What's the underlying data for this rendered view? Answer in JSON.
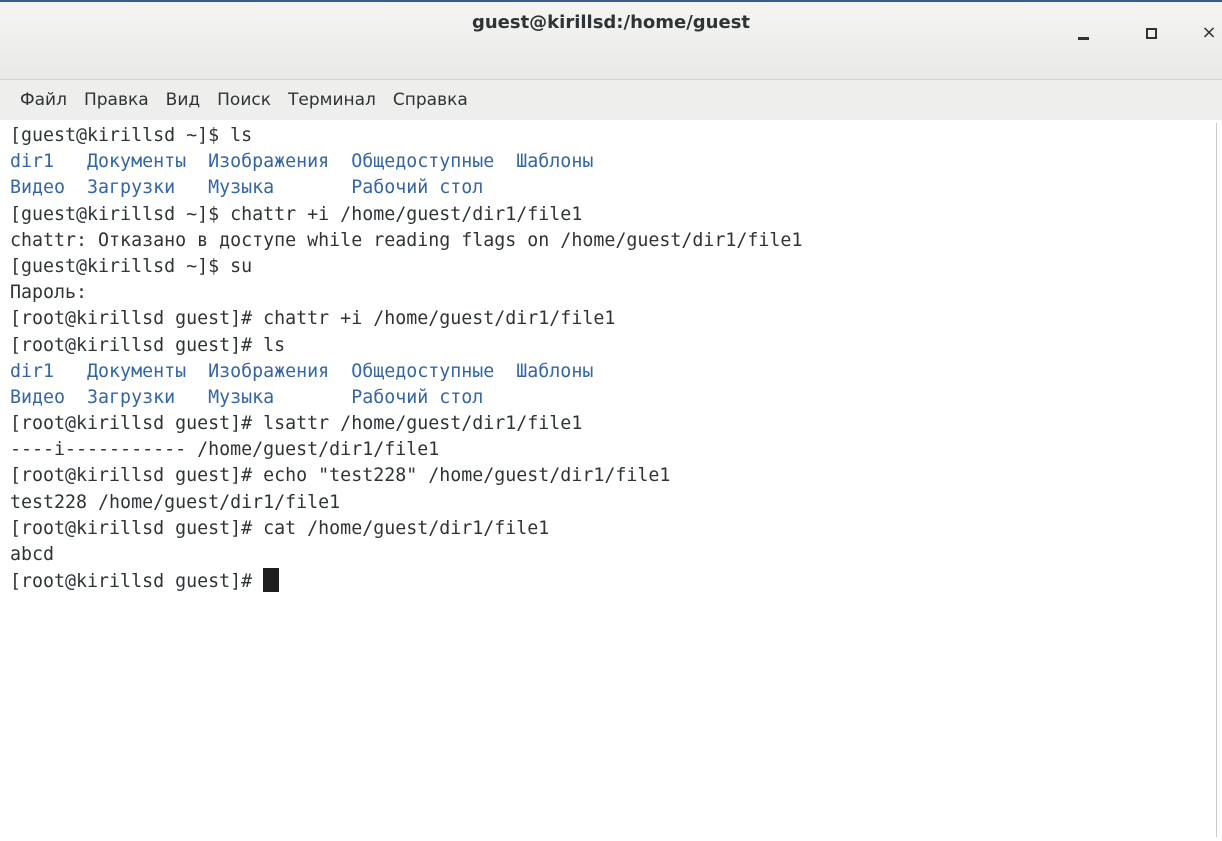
{
  "window": {
    "title": "guest@kirillsd:/home/guest",
    "close_glyph": "×"
  },
  "menu": [
    "Файл",
    "Правка",
    "Вид",
    "Поиск",
    "Терминал",
    "Справка"
  ],
  "colors": {
    "directory": "#3465a4",
    "text": "#2e3436"
  },
  "terminal": {
    "lines": [
      {
        "type": "text",
        "text": "[guest@kirillsd ~]$ ls"
      },
      {
        "type": "dirs",
        "text": "dir1   Документы  Изображения  Общедоступные  Шаблоны"
      },
      {
        "type": "dirs",
        "text": "Видео  Загрузки   Музыка       Рабочий стол"
      },
      {
        "type": "text",
        "text": "[guest@kirillsd ~]$ chattr +i /home/guest/dir1/file1"
      },
      {
        "type": "text",
        "text": "chattr: Отказано в доступе while reading flags on /home/guest/dir1/file1"
      },
      {
        "type": "text",
        "text": "[guest@kirillsd ~]$ su"
      },
      {
        "type": "text",
        "text": "Пароль:"
      },
      {
        "type": "text",
        "text": "[root@kirillsd guest]# chattr +i /home/guest/dir1/file1"
      },
      {
        "type": "text",
        "text": "[root@kirillsd guest]# ls"
      },
      {
        "type": "dirs",
        "text": "dir1   Документы  Изображения  Общедоступные  Шаблоны"
      },
      {
        "type": "dirs",
        "text": "Видео  Загрузки   Музыка       Рабочий стол"
      },
      {
        "type": "text",
        "text": "[root@kirillsd guest]# lsattr /home/guest/dir1/file1"
      },
      {
        "type": "text",
        "text": "----i----------- /home/guest/dir1/file1"
      },
      {
        "type": "text",
        "text": "[root@kirillsd guest]# echo \"test228\" /home/guest/dir1/file1"
      },
      {
        "type": "text",
        "text": "test228 /home/guest/dir1/file1"
      },
      {
        "type": "text",
        "text": "[root@kirillsd guest]# cat /home/guest/dir1/file1"
      },
      {
        "type": "text",
        "text": "abcd"
      },
      {
        "type": "prompt",
        "text": "[root@kirillsd guest]# "
      }
    ]
  }
}
